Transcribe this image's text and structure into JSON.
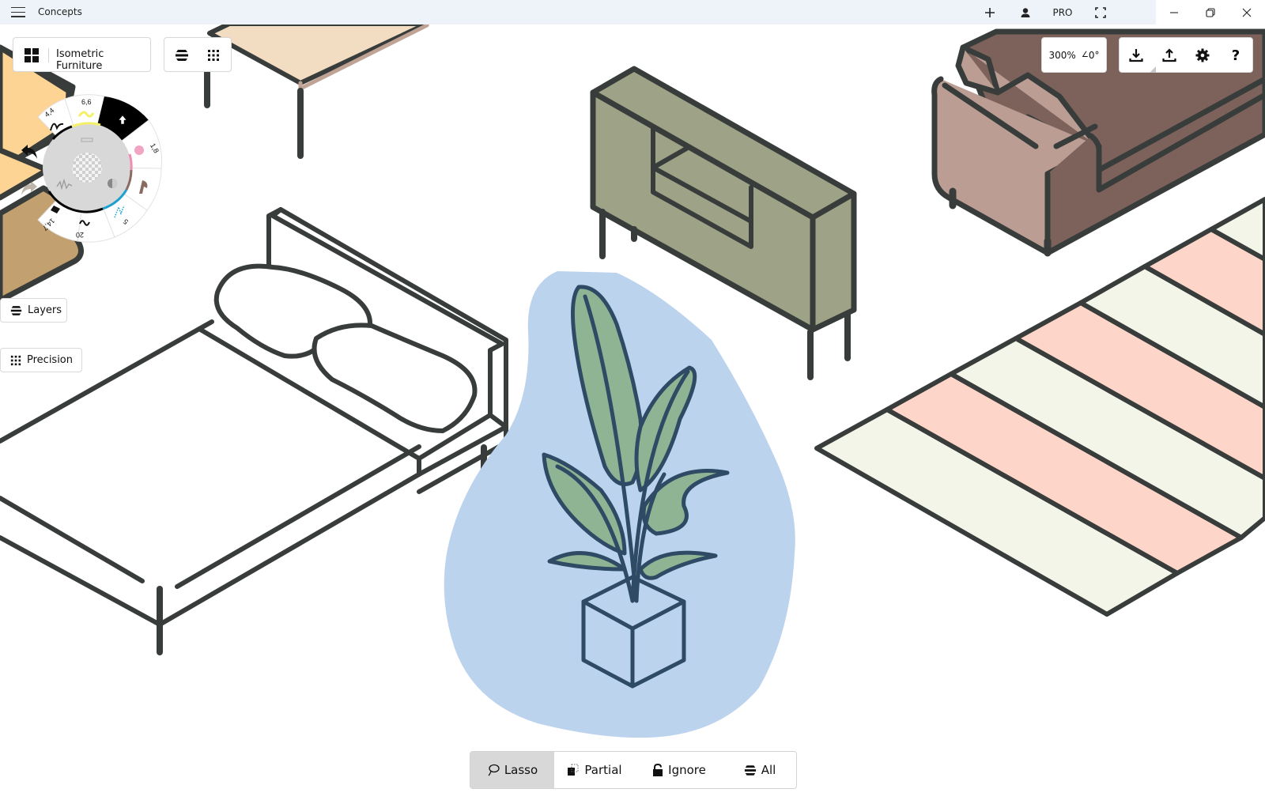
{
  "window": {
    "app_title": "Concepts",
    "titlebar_actions": [
      {
        "name": "new-drawing",
        "icon": "plus-icon",
        "label": "+"
      },
      {
        "name": "account",
        "icon": "user-icon",
        "label": ""
      },
      {
        "name": "pro",
        "icon": "",
        "label": "PRO"
      },
      {
        "name": "fullscreen",
        "icon": "fullscreen-icon",
        "label": ""
      }
    ],
    "controls": [
      {
        "name": "minimize",
        "icon": "minimize-icon"
      },
      {
        "name": "restore",
        "icon": "restore-icon"
      },
      {
        "name": "close",
        "icon": "close-icon"
      }
    ]
  },
  "toolbar": {
    "gallery_icon": "grid-icon",
    "document_title": "Isometric Furniture",
    "layers_toggle_icon": "layers-icon",
    "precision_toggle_icon": "grid-dots-icon"
  },
  "view": {
    "zoom": "300%",
    "rotation": "0°",
    "rotation_icon": "angle-icon"
  },
  "actions": [
    {
      "name": "import",
      "icon": "download-icon"
    },
    {
      "name": "export",
      "icon": "share-upload-icon"
    },
    {
      "name": "settings",
      "icon": "gear-icon"
    },
    {
      "name": "help",
      "icon": "help-icon",
      "label": "?"
    }
  ],
  "tool_wheel": {
    "undo_icon": "undo-icon",
    "redo_icon": "redo-icon",
    "slots": [
      {
        "name": "pen",
        "size": "4,4",
        "color": "#000000"
      },
      {
        "name": "highlighter",
        "size": "6,6",
        "color": "#f5f06a"
      },
      {
        "name": "selection",
        "size": "",
        "color": "#000000",
        "active": true
      },
      {
        "name": "airbrush",
        "size": "1,8",
        "color": "#f08cb4"
      },
      {
        "name": "fill",
        "size": "",
        "color": "#8a6b60"
      },
      {
        "name": "pencil",
        "size": "5",
        "color": "#1ba0d0"
      },
      {
        "name": "brush",
        "size": "20",
        "color": "#000000"
      },
      {
        "name": "eraser",
        "size": "14,7",
        "color": "#000000"
      }
    ],
    "center_icon": "transparent-color-icon",
    "opacity_icon": "contrast-icon",
    "smoothing_icon": "squiggle-icon"
  },
  "side_buttons": {
    "layers": "Layers",
    "precision": "Precision"
  },
  "selection_modes": [
    {
      "name": "lasso",
      "label": "Lasso",
      "icon": "lasso-icon",
      "active": true
    },
    {
      "name": "partial",
      "label": "Partial",
      "icon": "partial-select-icon",
      "active": false
    },
    {
      "name": "ignore",
      "label": "Ignore",
      "icon": "lock-icon",
      "active": false
    },
    {
      "name": "all",
      "label": "All",
      "icon": "layers-icon",
      "active": false
    }
  ],
  "palette": {
    "outline": "#383d3b",
    "sideboard": "#9ea387",
    "sofa_light": "#bb9d94",
    "sofa_dark": "#7d625c",
    "rug_pink": "#fed6c9",
    "rug_cream": "#f3f5e9",
    "plant_bg": "#bcd3ee",
    "plant_leaf": "#8fb494",
    "plant_line": "#2e4a64",
    "table_top": "#f2dcc2",
    "table_edge": "#c0a395",
    "drawer_light": "#fdd493",
    "drawer_dark": "#c2a070"
  }
}
